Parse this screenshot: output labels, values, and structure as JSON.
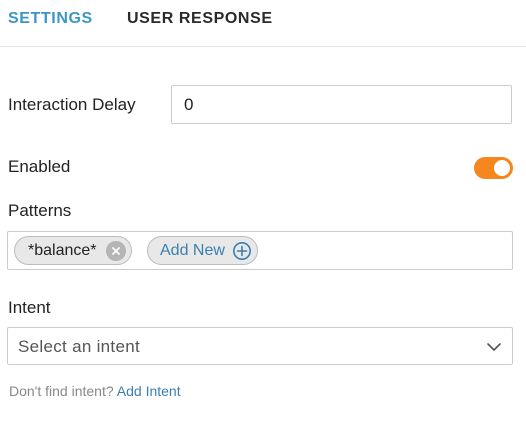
{
  "tabs": {
    "settings": "SETTINGS",
    "user_response": "USER RESPONSE"
  },
  "form": {
    "interaction_delay": {
      "label": "Interaction Delay",
      "value": "0"
    },
    "enabled": {
      "label": "Enabled",
      "state": "on"
    },
    "patterns": {
      "label": "Patterns",
      "items": [
        "*balance*"
      ],
      "add_label": "Add New"
    },
    "intent": {
      "label": "Intent",
      "placeholder": "Select an intent"
    },
    "hint": {
      "text": "Don't find intent?",
      "link": "Add Intent"
    }
  },
  "colors": {
    "accent": "#3a96c8",
    "toggle_on": "#f5871f",
    "link": "#3a7fb0"
  },
  "icons": {
    "remove": "close-circle-icon",
    "add": "plus-circle-icon",
    "dropdown": "chevron-down-icon"
  }
}
